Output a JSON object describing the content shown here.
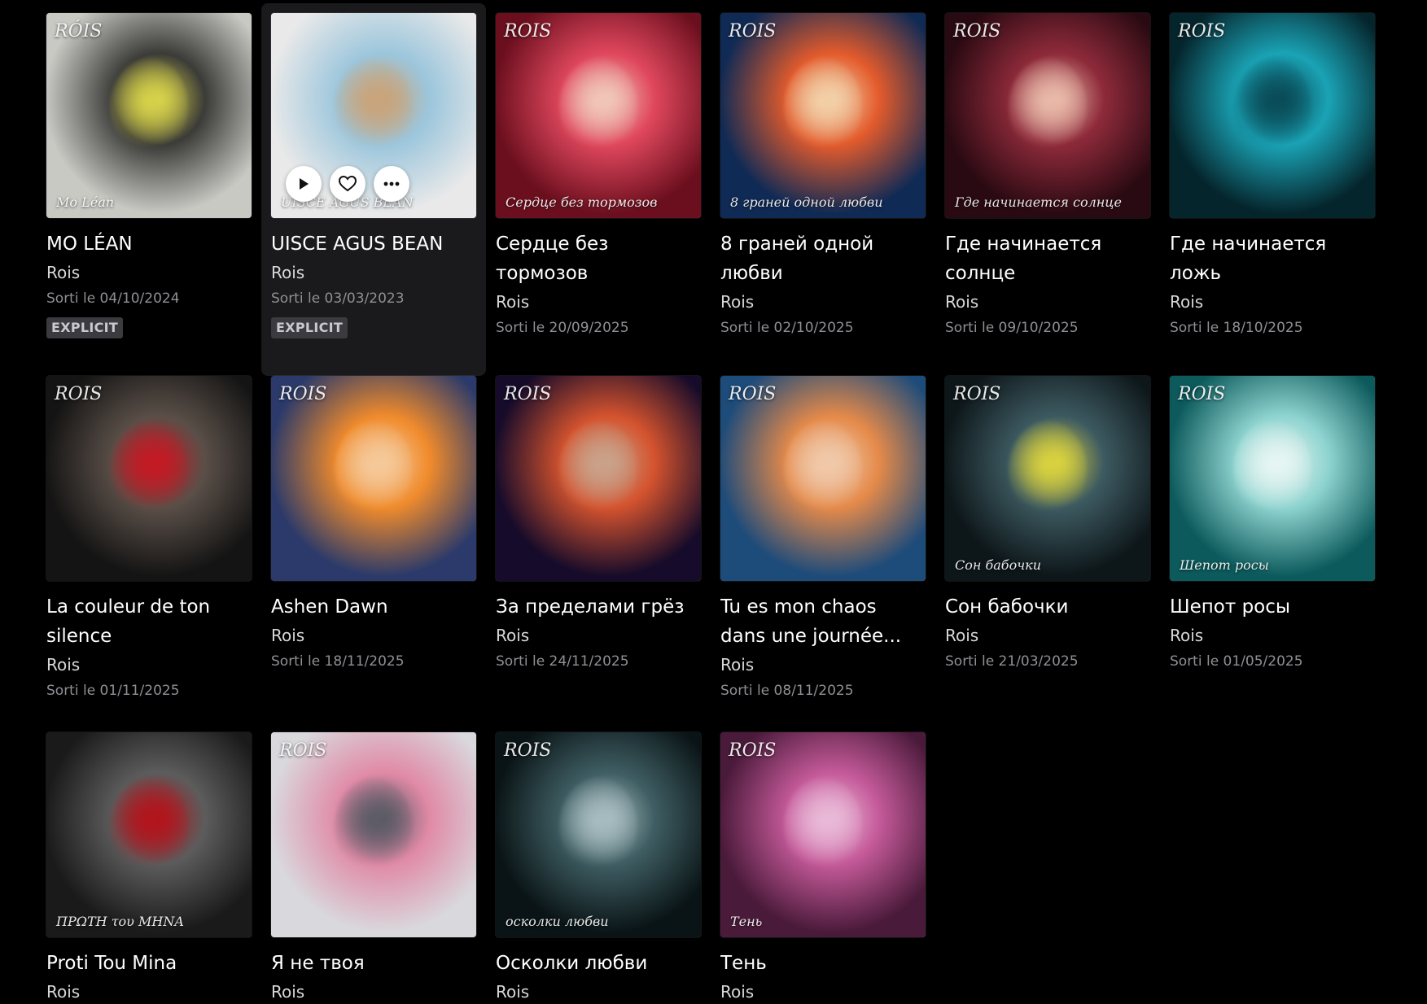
{
  "albums": [
    {
      "title": "MO LÉAN",
      "artist": "Rois",
      "date": "Sorti le 04/10/2024",
      "badge": "EXPLICIT",
      "cover_text": "Mo Léan",
      "cover_text2": "RÓIS",
      "palette": [
        "#c9c9c4",
        "#3b3b38",
        "#d7d24a"
      ]
    },
    {
      "title": "UISCE AGUS BEAN",
      "artist": "Rois",
      "date": "Sorti le 03/03/2023",
      "badge": "EXPLICIT",
      "cover_text": "UISCE AGUS BEAN",
      "palette": [
        "#e9e9e9",
        "#9cc6dc",
        "#c9a47a"
      ],
      "hovered": true,
      "actions": {
        "play": "play",
        "like": "like",
        "more": "more"
      }
    },
    {
      "title": "Сердце без тормозов",
      "artist": "Rois",
      "date": "Sorti le 20/09/2025",
      "badge": "",
      "cover_text": "Сердце без тормозов",
      "cover_text2": "ROIS",
      "palette": [
        "#6b0f1e",
        "#e0475d",
        "#f0c6b8"
      ]
    },
    {
      "title": "8 граней одной любви",
      "artist": "Rois",
      "date": "Sorti le 02/10/2025",
      "badge": "",
      "cover_text": "8 граней одной любви",
      "cover_text2": "ROIS",
      "palette": [
        "#0f2a55",
        "#e35b2c",
        "#f2d0a8"
      ]
    },
    {
      "title": "Где начинается солнце",
      "artist": "Rois",
      "date": "Sorti le 09/10/2025",
      "badge": "",
      "cover_text": "Где начинается солнце",
      "cover_text2": "ROIS",
      "palette": [
        "#2a0a12",
        "#8e2a3a",
        "#e9b9a9"
      ]
    },
    {
      "title": "Где начинается ложь",
      "artist": "Rois",
      "date": "Sorti le 18/10/2025",
      "badge": "",
      "cover_text": "",
      "cover_text2": "ROIS",
      "palette": [
        "#05252c",
        "#1aa3b5",
        "#0a4c58"
      ]
    },
    {
      "title": "La couleur de ton silence",
      "artist": "Rois",
      "date": "Sorti le 01/11/2025",
      "badge": "",
      "cover_text": "",
      "cover_text2": "ROIS",
      "palette": [
        "#141414",
        "#5a4f48",
        "#c41a24"
      ]
    },
    {
      "title": "Ashen Dawn",
      "artist": "Rois",
      "date": "Sorti le 18/11/2025",
      "badge": "",
      "cover_text": "",
      "cover_text2": "ROIS",
      "palette": [
        "#2b3a6a",
        "#f08b2c",
        "#f5c99a"
      ]
    },
    {
      "title": "За пределами грёз",
      "artist": "Rois",
      "date": "Sorti le 24/11/2025",
      "badge": "",
      "cover_text": "",
      "cover_text2": "ROIS",
      "palette": [
        "#160b2a",
        "#d4532e",
        "#c9a28a"
      ]
    },
    {
      "title": "Tu es mon chaos dans une journée...",
      "artist": "Rois",
      "date": "Sorti le 08/11/2025",
      "badge": "",
      "cover_text": "",
      "cover_text2": "ROIS",
      "palette": [
        "#1d4b7a",
        "#e58a4a",
        "#f0c9aa"
      ]
    },
    {
      "title": "Сон бабочки",
      "artist": "Rois",
      "date": "Sorti le 21/03/2025",
      "badge": "",
      "cover_text": "Сон бабочки",
      "cover_text2": "ROIS",
      "palette": [
        "#0d1619",
        "#3d5a61",
        "#d9d23f"
      ]
    },
    {
      "title": "Шепот росы",
      "artist": "Rois",
      "date": "Sorti le 01/05/2025",
      "badge": "",
      "cover_text": "Шепот росы",
      "cover_text2": "ROIS",
      "palette": [
        "#0c5a5c",
        "#8fd4d0",
        "#e6f5f2"
      ]
    },
    {
      "title": "Proti Tou Mina",
      "artist": "Rois",
      "date": "",
      "badge": "",
      "cover_text": "ΠΡΩΤΗ του ΜΗΝΑ",
      "cover_text2": "",
      "palette": [
        "#1a1a1a",
        "#5c5c5c",
        "#b3141c"
      ]
    },
    {
      "title": "Я не твоя",
      "artist": "Rois",
      "date": "",
      "badge": "",
      "cover_text": "",
      "cover_text2": "ROIS",
      "palette": [
        "#d9d9dd",
        "#e08aa6",
        "#5b5b66"
      ]
    },
    {
      "title": "Осколки любви",
      "artist": "Rois",
      "date": "",
      "badge": "",
      "cover_text": "осколки любви",
      "cover_text2": "ROIS",
      "palette": [
        "#0a1416",
        "#3f5e63",
        "#a7bcc0"
      ]
    },
    {
      "title": "Тень",
      "artist": "Rois",
      "date": "",
      "badge": "",
      "cover_text": "Тень",
      "cover_text2": "ROIS",
      "palette": [
        "#4a1a3a",
        "#c55a9a",
        "#e9b9d7"
      ]
    }
  ]
}
